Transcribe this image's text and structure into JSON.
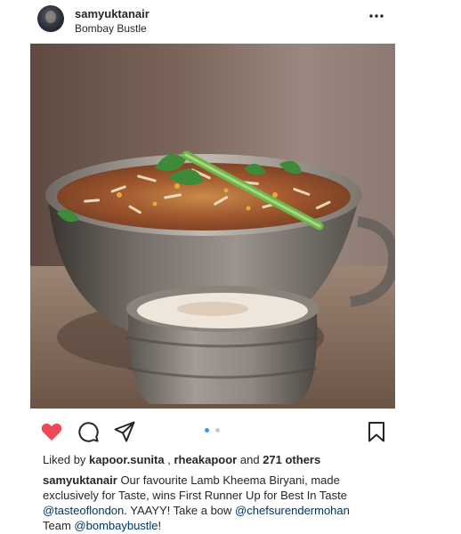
{
  "post": {
    "username": "samyuktanair",
    "location": "Bombay Bustle",
    "slide_count": 2,
    "active_slide": 1,
    "liked": true
  },
  "icons": {
    "more": "more-options-icon",
    "like": "heart-icon",
    "comment": "comment-icon",
    "share": "send-icon",
    "save": "bookmark-icon"
  },
  "colors": {
    "like_red": "#ed4956",
    "active_dot": "#3897f0",
    "inactive_dot": "#c7c7c7",
    "mention": "#003569",
    "text": "#262626"
  },
  "likes": {
    "prefix": "Liked by ",
    "user1": "kapoor.sunita",
    "separator": ", ",
    "user2": "rheakapoor",
    "middle": " and ",
    "others": "271 others"
  },
  "caption": {
    "username": "samyuktanair",
    "line1_text": " Our favourite Lamb Kheema Biryani, made",
    "line2_text": "exclusively for Taste, wins First Runner Up for Best In Taste",
    "mention1": "@tasteoflondon",
    "line3_mid": ". YAAYY! Take a bow ",
    "mention2": "@chefsurendermohan",
    "line4_prefix": "Team ",
    "mention3": "@bombaybustle",
    "line4_suffix": "!"
  }
}
